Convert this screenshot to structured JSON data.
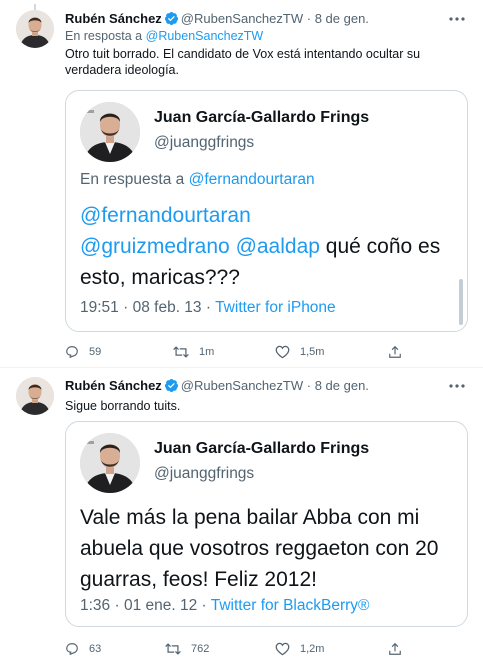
{
  "tweets": [
    {
      "author": {
        "name": "Rubén Sánchez",
        "handle": "@RubenSanchezTW",
        "separator": "·",
        "date": "8 de gen."
      },
      "reply_to": {
        "prefix": "En resposta a",
        "target": "@RubenSanchezTW"
      },
      "text": "Otro tuit borrado. El candidato de Vox está intentando ocultar su verdadera ideología.",
      "quoted": {
        "name": "Juan García-Gallardo Frings",
        "handle": "@juanggfrings",
        "reply_to": {
          "prefix": "En respuesta a",
          "target": "@fernandourtaran"
        },
        "body": {
          "mention_1": "@fernandourtaran",
          "mention_2": "@gruizmedrano",
          "mention_3": "@aaldap",
          "text": "qué coño es esto, maricas???"
        },
        "meta": {
          "time": "19:51",
          "date": "08 feb. 13",
          "separator": "·",
          "source": "Twitter for iPhone"
        }
      },
      "stats": {
        "replies": "59",
        "retweets": "1m",
        "likes": "1,5m"
      }
    },
    {
      "author": {
        "name": "Rubén Sánchez",
        "handle": "@RubenSanchezTW",
        "separator": "·",
        "date": "8 de gen."
      },
      "text": "Sigue borrando tuits.",
      "quoted": {
        "name": "Juan García-Gallardo Frings",
        "handle": "@juanggfrings",
        "body_text": "Vale más la pena bailar Abba con mi abuela que vosotros reggaeton con 20 guarras, feos! Feliz 2012!",
        "meta": {
          "time": "1:36",
          "date": "01 ene. 12",
          "separator": "·",
          "source": "Twitter for BlackBerry®"
        }
      },
      "stats": {
        "replies": "63",
        "retweets": "762",
        "likes": "1,2m"
      }
    }
  ],
  "colors": {
    "accent": "#1d9bf0",
    "text": "#0f1419",
    "secondary": "#536471",
    "border": "#cfd9de"
  },
  "icons": [
    "more-icon",
    "verified-badge-icon",
    "reply-icon",
    "retweet-icon",
    "like-icon",
    "share-icon"
  ]
}
